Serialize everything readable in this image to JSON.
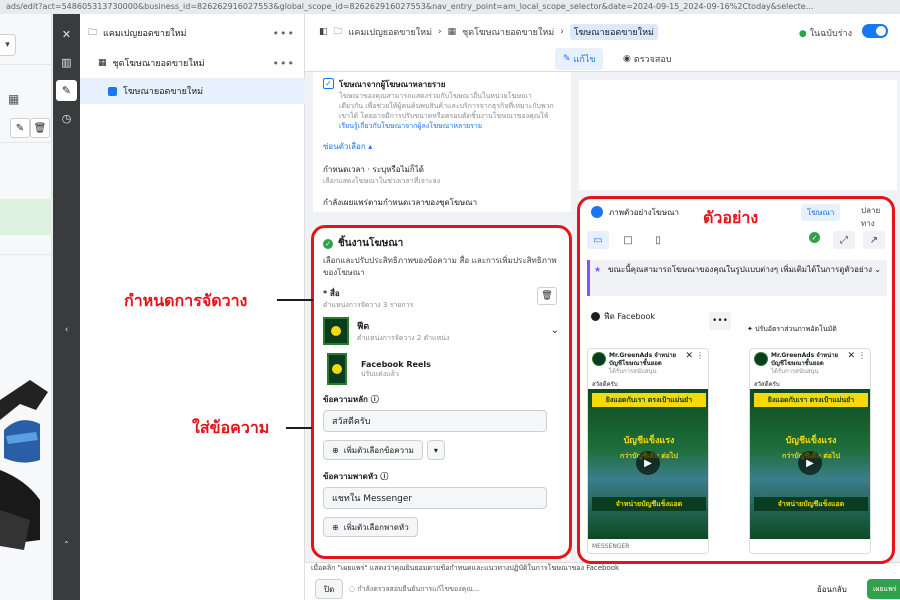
{
  "browser": {
    "url": "ads/edit?act=548605313730000&business_id=826262916027553&global_scope_id=826262916027553&nav_entry_point=am_local_scope_selector&date=2024-09-15_2024-09-16%2Ctoday&selecte..."
  },
  "tree": {
    "items": [
      {
        "label": "แคมเปญยอดขายใหม่"
      },
      {
        "label": "ชุดโฆษณายอดขายใหม่"
      },
      {
        "label": "โฆษณายอดขายใหม่"
      }
    ],
    "more": "•••"
  },
  "header": {
    "breadcrumbs": [
      "แคมเปญยอดขายใหม่",
      "ชุดโฆษณายอดขายใหม่",
      "โฆษณายอดขายใหม่"
    ],
    "status": "ในฉบับร่าง",
    "tab_edit": "แก้ไข",
    "tab_review": "ตรวจสอบ"
  },
  "multi_advertiser": {
    "title": "โฆษณาจากผู้โฆษณาหลายราย",
    "desc": "โฆษณาของคุณสามารถแสดงร่วมกับโฆษณาอื่นในหน่วยโฆษณาเดียวกัน เพื่อช่วยให้ผู้คนค้นพบสินค้าและบริการจากธุรกิจที่เหมาะกับพวกเขาได้ โดยอาจมีการปรับขนาดหรือครอบตัดชิ้นงานโฆษณาของคุณให้พอดีกับหน่วยโฆษณานั้น",
    "link": "เรียนรู้เกี่ยวกับโฆษณาจากผู้ลงโฆษณาหลายราย"
  },
  "schedule": {
    "options_toggle": "ซ่อนตัวเลือก",
    "label": "กำหนดเวลา · ระบุหรือไม่ก็ได้",
    "desc": "เลือกแสดงโฆษณาในช่วงเวลาที่เจาะจง",
    "note": "กำลังเผยแพร่ตามกำหนดเวลาของชุดโฆษณา"
  },
  "assets": {
    "title": "ชิ้นงานโฆษณา",
    "desc": "เลือกและปรับประสิทธิภาพของข้อความ สื่อ และการเพิ่มประสิทธิภาพของโฆษณา",
    "media_label": "* สื่อ",
    "media_count": "ตำแหน่งการจัดวาง 3 รายการ",
    "feed_name": "ฟีด",
    "feed_sub": "ตำแหน่งการจัดวาง 2 ตำแหน่ง",
    "reels_name": "Facebook Reels",
    "reels_sub": "ปรับแต่งแล้ว",
    "primary_text_label": "ข้อความหลัก",
    "primary_text_value": "สวัสดีครับ",
    "add_text_option": "เพิ่มตัวเลือกข้อความ",
    "headline_label": "ข้อความพาดหัว",
    "headline_value": "แชทใน Messenger",
    "add_headline_option": "เพิ่มตัวเลือกพาดหัว"
  },
  "preview": {
    "title": "ภาพตัวอย่างโฆษณา",
    "tab_ad": "โฆษณา",
    "tab_destination": "ปลายทาง",
    "info": "ขณะนี้คุณสามารถโฆษณาของคุณในรูปแบบต่างๆ เพิ่มเติมได้ในการดูตัวอย่าง",
    "feed_label": "ฟีด Facebook",
    "customize": "ปรับอัตราส่วนภาพอัตโนมัติ",
    "page_name": "Mr.GreenAds จำหน่ายบัญชีโฆษณาชั้นยอด",
    "sponsored": "ได้รับการสนับสนุน",
    "greeting": "สวัสดีครับ",
    "banner_top": "ยิงแอดกับเรา ตรงเป้าแม่นยำ",
    "banner_mid": "บัญชีแข็งแรง",
    "banner_mid2": "กว่าบัญชีเดิม ต่อไป",
    "banner_bottom": "จำหน่ายบัญชีแข็งแอด",
    "messenger": "MESSENGER"
  },
  "footer": {
    "text": "เมื่อคลิก \"เผยแพร่\" แสดงว่าคุณยินยอมตามข้อกำหนดและแนวทางปฏิบัติในการโฆษณาของ Facebook",
    "close": "ปิด",
    "status": "กำลังตรวจสอบยืนยันการแก้ไขของคุณ...",
    "back": "ย้อนกลับ",
    "publish": "เผยแพร่"
  },
  "annotations": {
    "placement": "กำหนดการจัดวาง",
    "text": "ใส่ข้อความ",
    "preview": "ตัวอย่าง"
  },
  "colors": {
    "brand_blue": "#1877f2",
    "success_green": "#31a24c",
    "annotation_red": "#e4141a"
  }
}
